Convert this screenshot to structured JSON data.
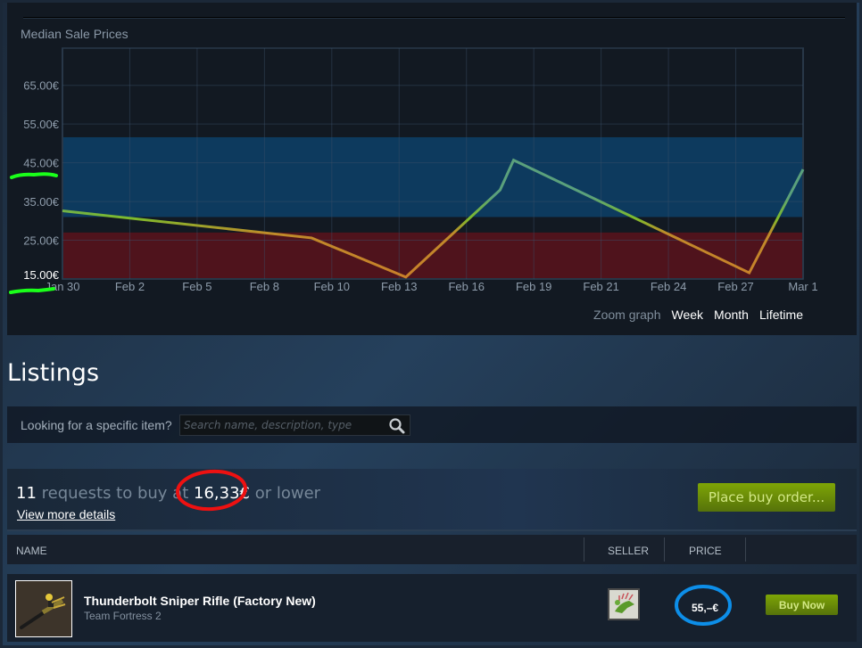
{
  "chart_data": {
    "type": "line",
    "title": "Median Sale Prices",
    "xlabel": "",
    "ylabel": "",
    "currency_suffix": "€",
    "y_ticks": [
      "15.00€",
      "25.00€",
      "35.00€",
      "45.00€",
      "55.00€",
      "65.00€"
    ],
    "y_tick_values": [
      15,
      25,
      35,
      45,
      55,
      65
    ],
    "ylim": [
      15,
      74.6
    ],
    "x_ticks": [
      "Jan 30",
      "Feb 2",
      "Feb 5",
      "Feb 8",
      "Feb 10",
      "Feb 13",
      "Feb 16",
      "Feb 19",
      "Feb 21",
      "Feb 24",
      "Feb 27",
      "Mar 1"
    ],
    "grid": true,
    "bands": [
      {
        "name": "upper-band",
        "from": 31.0,
        "to": 51.6,
        "color": "#0d3a5e"
      },
      {
        "name": "lower-band",
        "from": 15.0,
        "to": 27.0,
        "color": "#4f131c"
      }
    ],
    "series": [
      {
        "name": "Median sale price",
        "points": [
          {
            "x": 0.0,
            "y": 32.6
          },
          {
            "x": 3.7,
            "y": 25.6
          },
          {
            "x": 5.1,
            "y": 15.5
          },
          {
            "x": 6.5,
            "y": 38.0
          },
          {
            "x": 6.7,
            "y": 45.7
          },
          {
            "x": 10.2,
            "y": 16.6
          },
          {
            "x": 11.0,
            "y": 43.3
          }
        ]
      }
    ]
  },
  "chart_controls": {
    "zoom_label": "Zoom graph",
    "zoom_options": [
      "Week",
      "Month",
      "Lifetime"
    ]
  },
  "listings": {
    "title": "Listings",
    "search_label": "Looking for a specific item?",
    "search_placeholder": "Search name, description, type",
    "search_value": ""
  },
  "buy_orders": {
    "count": "11",
    "text_middle": "requests to buy at",
    "price": "16,33€",
    "text_end": "or lower",
    "details_link": "View more details",
    "place_order_button": "Place buy order..."
  },
  "table": {
    "columns": [
      "NAME",
      "SELLER",
      "PRICE"
    ],
    "rows": [
      {
        "item_name": "Thunderbolt Sniper Rifle (Factory New)",
        "game": "Team Fortress 2",
        "price": "55,–€",
        "action": "Buy Now"
      }
    ]
  },
  "annotations": {
    "green_marks": [
      "45.00€",
      "15.00€"
    ],
    "red_circle": "16,33€",
    "blue_circle": "55,–€"
  }
}
